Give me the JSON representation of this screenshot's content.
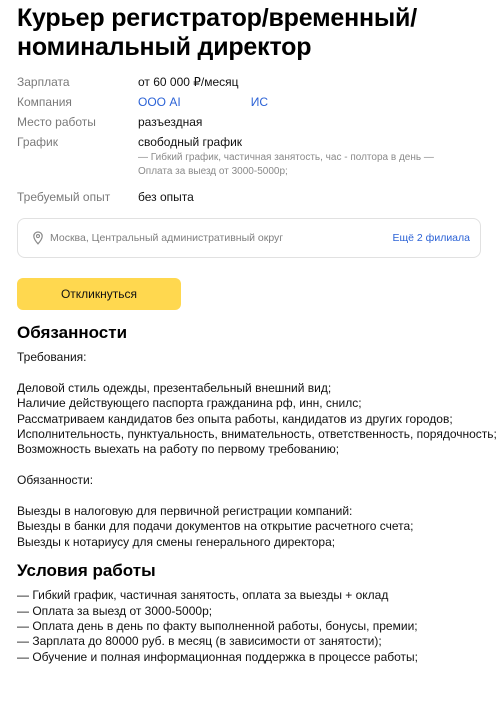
{
  "vacancy": {
    "title": "Курьер регистратор/временный/ номинальный директор"
  },
  "props": {
    "salary_label": "Зарплата",
    "salary_value": "от 60 000 ₽/месяц",
    "company_label": "Компания",
    "company_value": "ООО АІ                     ИС",
    "place_label": "Место работы",
    "place_value": "разъездная",
    "schedule_label": "График",
    "schedule_value": "свободный график",
    "schedule_note": "— Гибкий график, частичная занятость, час - полтора в день — Оплата за выезд от 3000-5000р;",
    "experience_label": "Требуемый опыт",
    "experience_value": "без опыта"
  },
  "location": {
    "icon": "map-pin-icon",
    "address": "Москва, Центральный административный округ",
    "more_link": "Ещё 2 филиала"
  },
  "respond_button": "Откликнуться",
  "duties": {
    "heading": "Обязанности",
    "requirements_label": "Требования:",
    "requirements": [
      "Деловой стиль одежды, презентабельный внешний вид;",
      "Наличие действующего паспорта гражданина рф, инн, снилс;",
      "Рассматриваем кандидатов без опыта работы, кандидатов из других городов;",
      "Исполнительность, пунктуальность, внимательность, ответственность, порядочность;",
      "Возможность выехать на работу по первому требованию;"
    ],
    "duties_label": "Обязанности:",
    "duties_list": [
      "Выезды в налоговую для первичной регистрации компаний:",
      "Выезды в банки для подачи документов на открытие расчетного счета;",
      "Выезды к нотариусу для смены генерального директора;"
    ]
  },
  "conditions": {
    "heading": "Условия работы",
    "items": [
      "— Гибкий график, частичная занятость, оплата за выезды + оклад",
      "— Оплата за выезд от 3000-5000р;",
      "— Оплата день в день по факту выполненной работы, бонусы, премии;",
      "— Зарплата до 80000 руб. в месяц (в зависимости от занятости);",
      "— Обучение и полная информационная поддержка в процессе работы;"
    ]
  }
}
